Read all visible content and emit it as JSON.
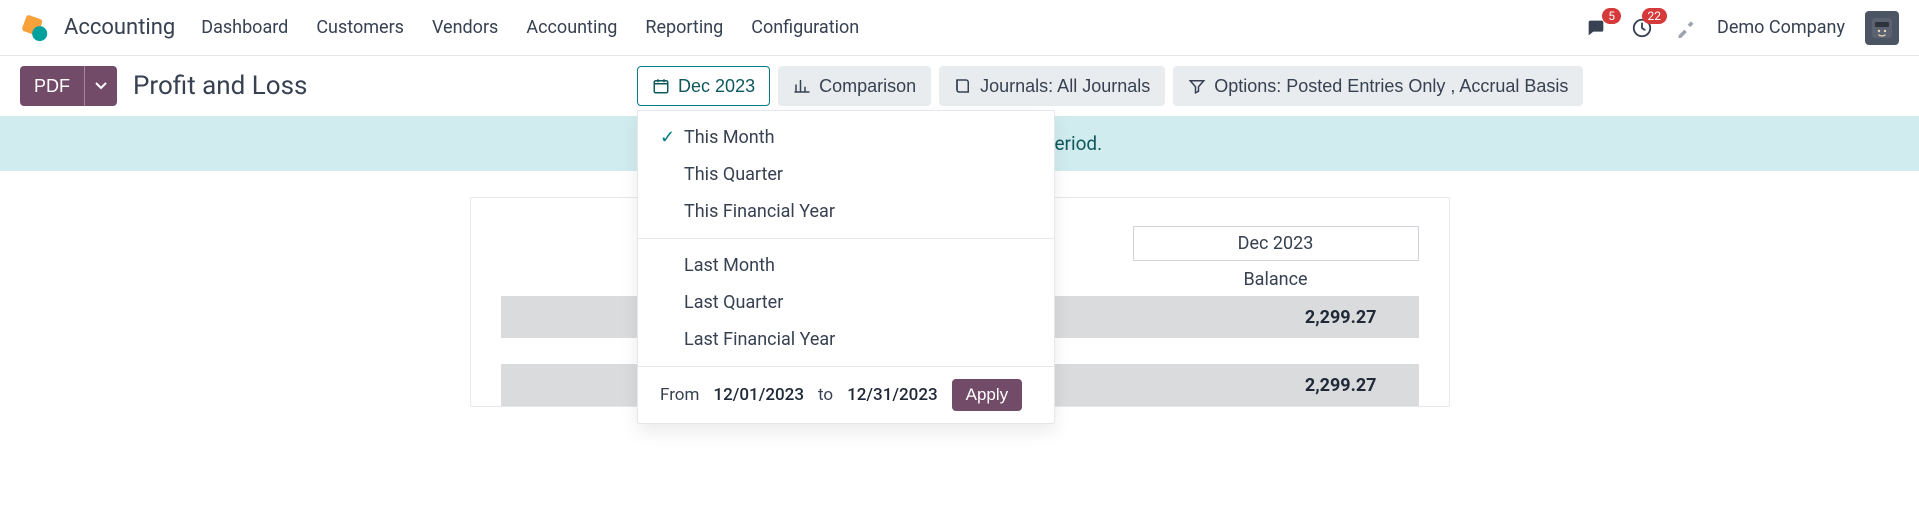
{
  "app": {
    "name": "Accounting"
  },
  "nav": {
    "items": [
      "Dashboard",
      "Customers",
      "Vendors",
      "Accounting",
      "Reporting",
      "Configuration"
    ]
  },
  "header_right": {
    "messages_badge": "5",
    "activities_badge": "22",
    "company": "Demo Company"
  },
  "controlbar": {
    "pdf_label": "PDF",
    "title": "Profit and Loss"
  },
  "filters": {
    "period_label": "Dec 2023",
    "comparison_label": "Comparison",
    "journals_label": "Journals: All Journals",
    "options_label": "Options: Posted Entries Only , Accrual Basis"
  },
  "period_dropdown": {
    "group1": [
      {
        "label": "This Month",
        "selected": true
      },
      {
        "label": "This Quarter",
        "selected": false
      },
      {
        "label": "This Financial Year",
        "selected": false
      }
    ],
    "group2": [
      {
        "label": "Last Month",
        "selected": false
      },
      {
        "label": "Last Quarter",
        "selected": false
      },
      {
        "label": "Last Financial Year",
        "selected": false
      }
    ],
    "range": {
      "from_label": "From",
      "from_value": "12/01/2023",
      "to_label": "to",
      "to_value": "12/31/2023",
      "apply_label": "Apply"
    }
  },
  "banner": {
    "text_fragment": "ies prior or included in this period."
  },
  "report": {
    "column_period": "Dec 2023",
    "balance_label": "Balance",
    "rows": [
      {
        "amount": "2,299.27"
      },
      {
        "amount": "2,299.27"
      }
    ]
  }
}
